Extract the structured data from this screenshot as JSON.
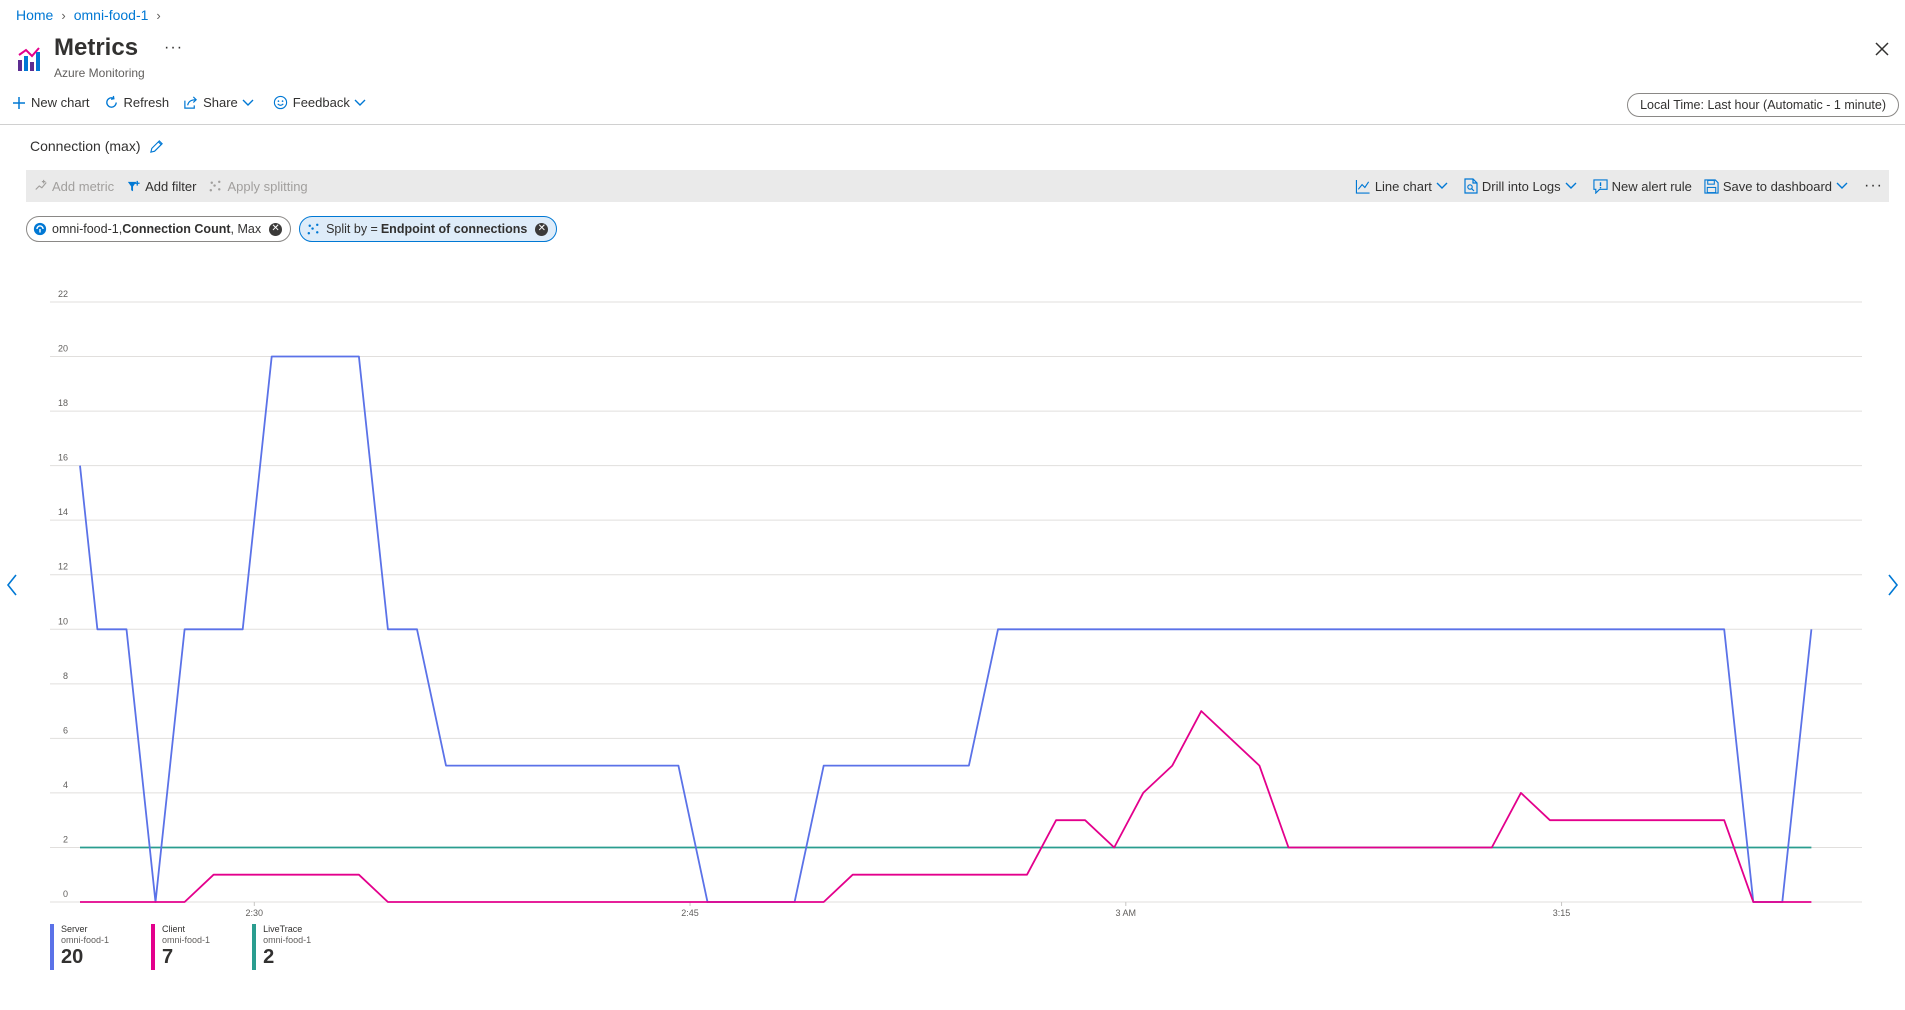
{
  "breadcrumb": {
    "home": "Home",
    "resource": "omni-food-1"
  },
  "header": {
    "title": "Metrics",
    "more": "···",
    "subtitle": "Azure Monitoring"
  },
  "commands": {
    "new_chart": "New chart",
    "refresh": "Refresh",
    "share": "Share",
    "feedback": "Feedback"
  },
  "time_range": "Local Time: Last hour (Automatic - 1 minute)",
  "chart_title": "Connection (max)",
  "toolbar": {
    "add_metric": "Add metric",
    "add_filter": "Add filter",
    "apply_splitting": "Apply splitting",
    "line_chart": "Line chart",
    "drill_logs": "Drill into Logs",
    "new_alert": "New alert rule",
    "save_dashboard": "Save to dashboard",
    "more": "···"
  },
  "pills": {
    "metric_resource": "omni-food-1,",
    "metric_name": "Connection Count",
    "metric_agg": ", Max",
    "split_prefix": "Split by =",
    "split_value": "Endpoint of connections"
  },
  "colors": {
    "server": "#5b72e8",
    "client": "#e3008c",
    "livetrace": "#2a9d8f",
    "accent": "#0078d4"
  },
  "chart_data": {
    "type": "line",
    "ylim": [
      0,
      22
    ],
    "y_ticks": [
      "0",
      "2",
      "4",
      "6",
      "8",
      "10",
      "12",
      "14",
      "16",
      "18",
      "20",
      "22"
    ],
    "x_ticks": [
      {
        "label": "2:30",
        "t": 6
      },
      {
        "label": "2:45",
        "t": 21
      },
      {
        "label": "3 AM",
        "t": 36
      },
      {
        "label": "3:15",
        "t": 51
      }
    ],
    "x_range": [
      0,
      60
    ],
    "series": [
      {
        "name": "Server",
        "resource": "omni-food-1",
        "color": "#5b72e8",
        "legend_value": "20",
        "points": [
          [
            0,
            16
          ],
          [
            0.6,
            10
          ],
          [
            1.6,
            10
          ],
          [
            2.6,
            0
          ],
          [
            3.6,
            10
          ],
          [
            5.6,
            10
          ],
          [
            6.6,
            20
          ],
          [
            9.6,
            20
          ],
          [
            10.6,
            10
          ],
          [
            11.6,
            10
          ],
          [
            12.6,
            5
          ],
          [
            20.6,
            5
          ],
          [
            21.6,
            0
          ],
          [
            24.6,
            0
          ],
          [
            25.6,
            5
          ],
          [
            30.6,
            5
          ],
          [
            31.6,
            10
          ],
          [
            56.6,
            10
          ],
          [
            57.6,
            0
          ],
          [
            58.6,
            0
          ],
          [
            59.6,
            10
          ]
        ]
      },
      {
        "name": "Client",
        "resource": "omni-food-1",
        "color": "#e3008c",
        "legend_value": "7",
        "points": [
          [
            0,
            0
          ],
          [
            3.6,
            0
          ],
          [
            4.6,
            1
          ],
          [
            9.6,
            1
          ],
          [
            10.6,
            0
          ],
          [
            25.6,
            0
          ],
          [
            26.6,
            1
          ],
          [
            32.6,
            1
          ],
          [
            33.6,
            3
          ],
          [
            34.6,
            3
          ],
          [
            35.6,
            2
          ],
          [
            36.6,
            4
          ],
          [
            37.6,
            5
          ],
          [
            38.6,
            7
          ],
          [
            40.6,
            5
          ],
          [
            41.6,
            2
          ],
          [
            48.6,
            2
          ],
          [
            49.6,
            4
          ],
          [
            50.6,
            3
          ],
          [
            56.6,
            3
          ],
          [
            57.6,
            0
          ],
          [
            59.6,
            0
          ]
        ]
      },
      {
        "name": "LiveTrace",
        "resource": "omni-food-1",
        "color": "#2a9d8f",
        "legend_value": "2",
        "points": [
          [
            0,
            2
          ],
          [
            59.6,
            2
          ]
        ]
      }
    ]
  }
}
